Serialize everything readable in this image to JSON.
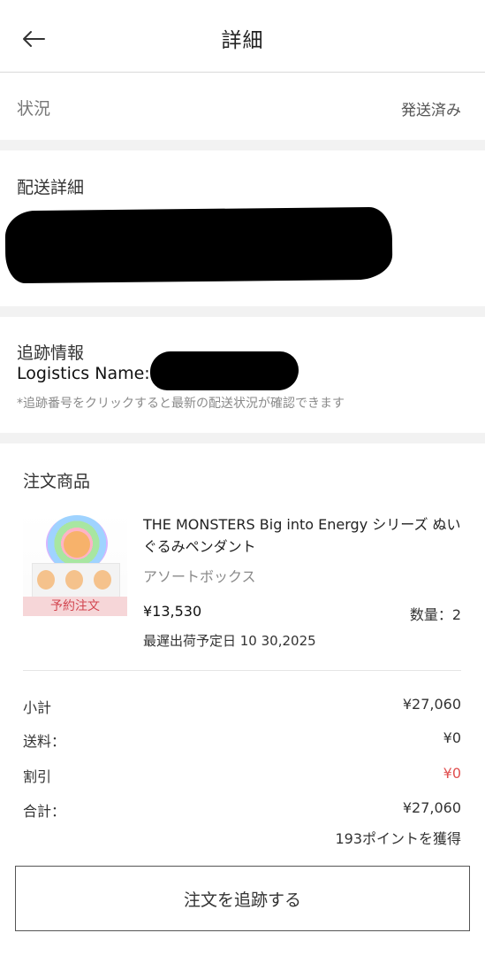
{
  "header": {
    "title": "詳細",
    "back_icon": "arrow-left-icon"
  },
  "status": {
    "label": "状況",
    "value": "発送済み"
  },
  "delivery": {
    "title": "配送詳細"
  },
  "tracking": {
    "title": "追跡情報",
    "logistics_label": "Logistics Name:",
    "note": "*追跡番号をクリックすると最新の配送状況が確認できます"
  },
  "order": {
    "title": "注文商品",
    "product": {
      "image_text": "THE MONSTERS Big into Energy",
      "tag": "予約注文",
      "name": "THE MONSTERS Big into Energy シリーズ ぬいぐるみペンダント",
      "variant": "アソートボックス",
      "price": "¥13,530",
      "quantity": "数量：2",
      "ship_date": "最遅出荷予定日 10 30,2025"
    }
  },
  "summary": {
    "subtotal_label": "小計",
    "subtotal_value": "¥27,060",
    "shipping_label": "送料：",
    "shipping_value": "¥0",
    "discount_label": "割引",
    "discount_value": "¥0",
    "total_label": "合計：",
    "total_value": "¥27,060",
    "points": "193ポイントを獲得"
  },
  "actions": {
    "track_button": "注文を追跡する"
  },
  "colors": {
    "discount": "#e05050",
    "preorder_tag_bg": "#f6d6d8",
    "preorder_tag_text": "#d2454f",
    "section_gap": "#f2f2f2"
  }
}
